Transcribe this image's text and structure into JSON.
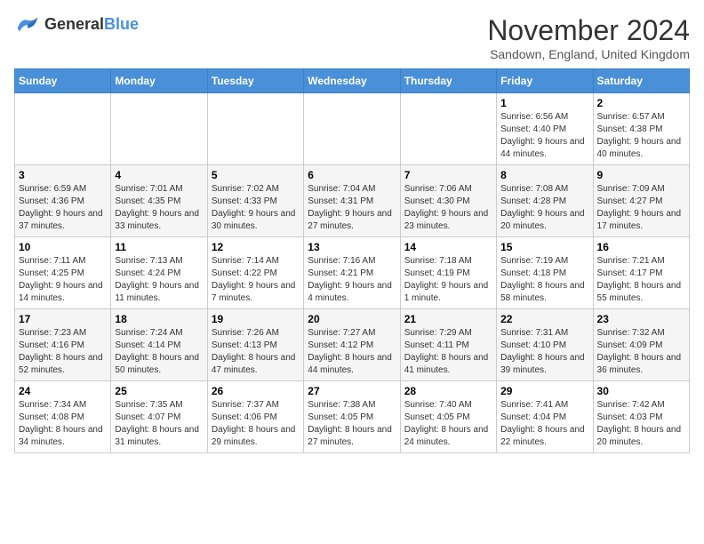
{
  "header": {
    "logo_general": "General",
    "logo_blue": "Blue",
    "month_title": "November 2024",
    "subtitle": "Sandown, England, United Kingdom"
  },
  "days_of_week": [
    "Sunday",
    "Monday",
    "Tuesday",
    "Wednesday",
    "Thursday",
    "Friday",
    "Saturday"
  ],
  "weeks": [
    [
      {
        "day": "",
        "info": ""
      },
      {
        "day": "",
        "info": ""
      },
      {
        "day": "",
        "info": ""
      },
      {
        "day": "",
        "info": ""
      },
      {
        "day": "",
        "info": ""
      },
      {
        "day": "1",
        "info": "Sunrise: 6:56 AM\nSunset: 4:40 PM\nDaylight: 9 hours and 44 minutes."
      },
      {
        "day": "2",
        "info": "Sunrise: 6:57 AM\nSunset: 4:38 PM\nDaylight: 9 hours and 40 minutes."
      }
    ],
    [
      {
        "day": "3",
        "info": "Sunrise: 6:59 AM\nSunset: 4:36 PM\nDaylight: 9 hours and 37 minutes."
      },
      {
        "day": "4",
        "info": "Sunrise: 7:01 AM\nSunset: 4:35 PM\nDaylight: 9 hours and 33 minutes."
      },
      {
        "day": "5",
        "info": "Sunrise: 7:02 AM\nSunset: 4:33 PM\nDaylight: 9 hours and 30 minutes."
      },
      {
        "day": "6",
        "info": "Sunrise: 7:04 AM\nSunset: 4:31 PM\nDaylight: 9 hours and 27 minutes."
      },
      {
        "day": "7",
        "info": "Sunrise: 7:06 AM\nSunset: 4:30 PM\nDaylight: 9 hours and 23 minutes."
      },
      {
        "day": "8",
        "info": "Sunrise: 7:08 AM\nSunset: 4:28 PM\nDaylight: 9 hours and 20 minutes."
      },
      {
        "day": "9",
        "info": "Sunrise: 7:09 AM\nSunset: 4:27 PM\nDaylight: 9 hours and 17 minutes."
      }
    ],
    [
      {
        "day": "10",
        "info": "Sunrise: 7:11 AM\nSunset: 4:25 PM\nDaylight: 9 hours and 14 minutes."
      },
      {
        "day": "11",
        "info": "Sunrise: 7:13 AM\nSunset: 4:24 PM\nDaylight: 9 hours and 11 minutes."
      },
      {
        "day": "12",
        "info": "Sunrise: 7:14 AM\nSunset: 4:22 PM\nDaylight: 9 hours and 7 minutes."
      },
      {
        "day": "13",
        "info": "Sunrise: 7:16 AM\nSunset: 4:21 PM\nDaylight: 9 hours and 4 minutes."
      },
      {
        "day": "14",
        "info": "Sunrise: 7:18 AM\nSunset: 4:19 PM\nDaylight: 9 hours and 1 minute."
      },
      {
        "day": "15",
        "info": "Sunrise: 7:19 AM\nSunset: 4:18 PM\nDaylight: 8 hours and 58 minutes."
      },
      {
        "day": "16",
        "info": "Sunrise: 7:21 AM\nSunset: 4:17 PM\nDaylight: 8 hours and 55 minutes."
      }
    ],
    [
      {
        "day": "17",
        "info": "Sunrise: 7:23 AM\nSunset: 4:16 PM\nDaylight: 8 hours and 52 minutes."
      },
      {
        "day": "18",
        "info": "Sunrise: 7:24 AM\nSunset: 4:14 PM\nDaylight: 8 hours and 50 minutes."
      },
      {
        "day": "19",
        "info": "Sunrise: 7:26 AM\nSunset: 4:13 PM\nDaylight: 8 hours and 47 minutes."
      },
      {
        "day": "20",
        "info": "Sunrise: 7:27 AM\nSunset: 4:12 PM\nDaylight: 8 hours and 44 minutes."
      },
      {
        "day": "21",
        "info": "Sunrise: 7:29 AM\nSunset: 4:11 PM\nDaylight: 8 hours and 41 minutes."
      },
      {
        "day": "22",
        "info": "Sunrise: 7:31 AM\nSunset: 4:10 PM\nDaylight: 8 hours and 39 minutes."
      },
      {
        "day": "23",
        "info": "Sunrise: 7:32 AM\nSunset: 4:09 PM\nDaylight: 8 hours and 36 minutes."
      }
    ],
    [
      {
        "day": "24",
        "info": "Sunrise: 7:34 AM\nSunset: 4:08 PM\nDaylight: 8 hours and 34 minutes."
      },
      {
        "day": "25",
        "info": "Sunrise: 7:35 AM\nSunset: 4:07 PM\nDaylight: 8 hours and 31 minutes."
      },
      {
        "day": "26",
        "info": "Sunrise: 7:37 AM\nSunset: 4:06 PM\nDaylight: 8 hours and 29 minutes."
      },
      {
        "day": "27",
        "info": "Sunrise: 7:38 AM\nSunset: 4:05 PM\nDaylight: 8 hours and 27 minutes."
      },
      {
        "day": "28",
        "info": "Sunrise: 7:40 AM\nSunset: 4:05 PM\nDaylight: 8 hours and 24 minutes."
      },
      {
        "day": "29",
        "info": "Sunrise: 7:41 AM\nSunset: 4:04 PM\nDaylight: 8 hours and 22 minutes."
      },
      {
        "day": "30",
        "info": "Sunrise: 7:42 AM\nSunset: 4:03 PM\nDaylight: 8 hours and 20 minutes."
      }
    ]
  ]
}
